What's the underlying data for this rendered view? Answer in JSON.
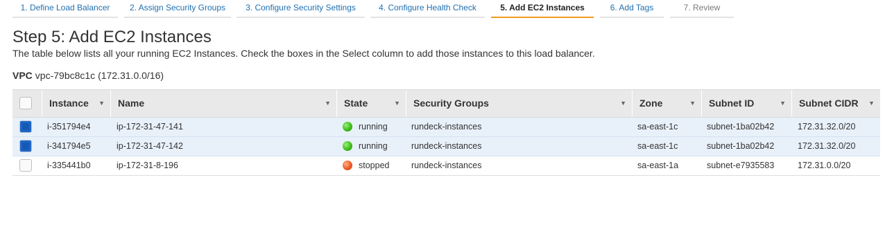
{
  "wizard": {
    "steps": [
      {
        "label": "1. Define Load Balancer"
      },
      {
        "label": "2. Assign Security Groups"
      },
      {
        "label": "3. Configure Security Settings"
      },
      {
        "label": "4. Configure Health Check"
      },
      {
        "label": "5. Add EC2 Instances"
      },
      {
        "label": "6. Add Tags"
      },
      {
        "label": "7. Review"
      }
    ],
    "active_index": 4
  },
  "page": {
    "title": "Step 5: Add EC2 Instances",
    "description": "The table below lists all your running EC2 Instances. Check the boxes in the Select column to add those instances to this load balancer.",
    "vpc_label": "VPC",
    "vpc_value": "vpc-79bc8c1c (172.31.0.0/16)"
  },
  "table": {
    "columns": [
      "Instance",
      "Name",
      "State",
      "Security Groups",
      "Zone",
      "Subnet ID",
      "Subnet CIDR"
    ],
    "sort_glyph": "▼",
    "rows": [
      {
        "checked": true,
        "instance": "i-351794e4",
        "name": "ip-172-31-47-141",
        "state": "running",
        "state_color": "green",
        "security_groups": "rundeck-instances",
        "zone": "sa-east-1c",
        "subnet_id": "subnet-1ba02b42",
        "subnet_cidr": "172.31.32.0/20"
      },
      {
        "checked": true,
        "instance": "i-341794e5",
        "name": "ip-172-31-47-142",
        "state": "running",
        "state_color": "green",
        "security_groups": "rundeck-instances",
        "zone": "sa-east-1c",
        "subnet_id": "subnet-1ba02b42",
        "subnet_cidr": "172.31.32.0/20"
      },
      {
        "checked": false,
        "instance": "i-335441b0",
        "name": "ip-172-31-8-196",
        "state": "stopped",
        "state_color": "red",
        "security_groups": "rundeck-instances",
        "zone": "sa-east-1a",
        "subnet_id": "subnet-e7935583",
        "subnet_cidr": "172.31.0.0/20"
      }
    ]
  },
  "colors": {
    "link": "#1f6fb0",
    "active_tab_underline": "#f39a1e",
    "selected_row": "#e8f0f9",
    "running": "#3ebd1a",
    "stopped": "#ee5a26",
    "checkbox_checked": "#1f66c4"
  }
}
